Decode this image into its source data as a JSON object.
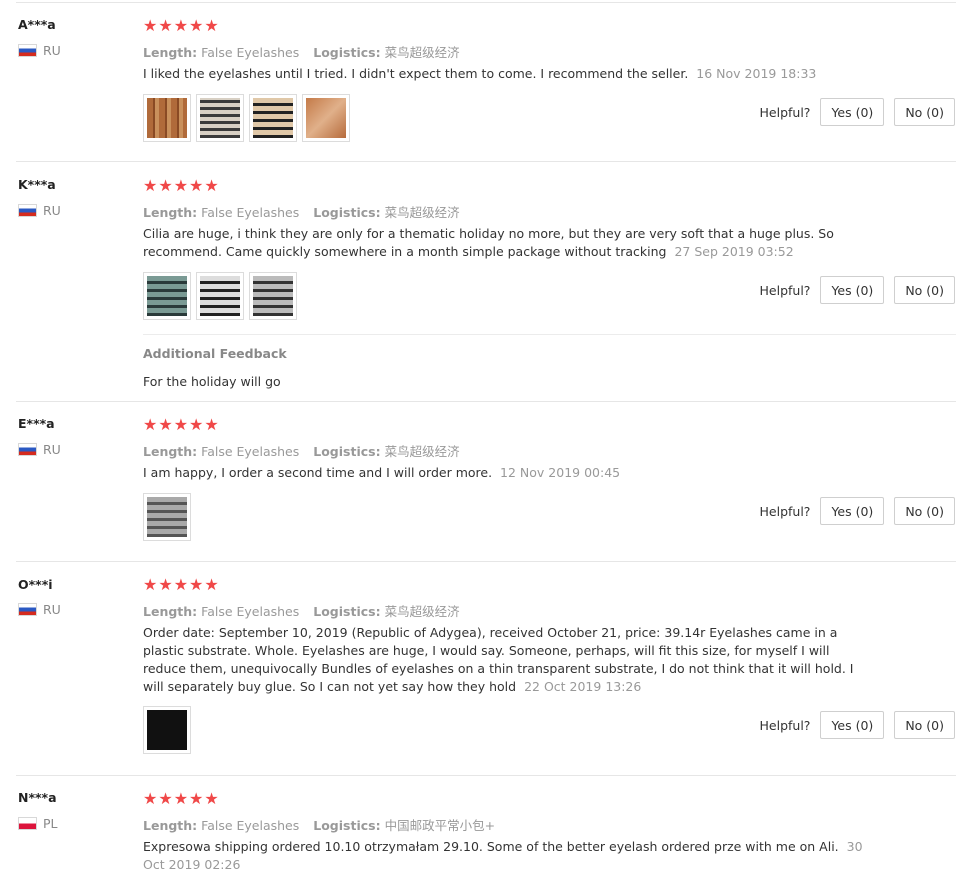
{
  "helpful_label": "Helpful?",
  "length_key": "Length:",
  "logistics_key": "Logistics:",
  "reviews": [
    {
      "user": "A***a",
      "country": "RU",
      "rating": 5,
      "length": "False Eyelashes",
      "logistics": "菜鸟超级经济",
      "text": "I liked the eyelashes until I tried. I didn't expect them to come. I recommend the seller.",
      "date": "16 Nov 2019 18:33",
      "thumbs": 4,
      "yes": "Yes (0)",
      "no": "No (0)"
    },
    {
      "user": "K***a",
      "country": "RU",
      "rating": 5,
      "length": "False Eyelashes",
      "logistics": "菜鸟超级经济",
      "text": "Cilia are huge, i think they are only for a thematic holiday no more, but they are very soft that a huge plus. So recommend. Came quickly somewhere in a month simple package without tracking",
      "date": "27 Sep 2019 03:52",
      "thumbs": 3,
      "yes": "Yes (0)",
      "no": "No (0)",
      "additional_title": "Additional Feedback",
      "additional_text": "For the holiday will go"
    },
    {
      "user": "E***a",
      "country": "RU",
      "rating": 5,
      "length": "False Eyelashes",
      "logistics": "菜鸟超级经济",
      "text": "I am happy, I order a second time and I will order more.",
      "date": "12 Nov 2019 00:45",
      "thumbs": 1,
      "yes": "Yes (0)",
      "no": "No (0)"
    },
    {
      "user": "O***i",
      "country": "RU",
      "rating": 5,
      "length": "False Eyelashes",
      "logistics": "菜鸟超级经济",
      "text": "Order date: September 10, 2019 (Republic of Adygea), received October 21, price: 39.14r Eyelashes came in a plastic substrate. Whole. Eyelashes are huge, I would say. Someone, perhaps, will fit this size, for myself I will reduce them, unequivocally Bundles of eyelashes on a thin transparent substrate, I do not think that it will hold. I will separately buy glue. So I can not yet say how they hold",
      "date": "22 Oct 2019 13:26",
      "thumbs": 1,
      "yes": "Yes (0)",
      "no": "No (0)"
    },
    {
      "user": "N***a",
      "country": "PL",
      "rating": 5,
      "length": "False Eyelashes",
      "logistics": "中国邮政平常小包+",
      "text": "Expresowa shipping ordered 10.10 otrzymałam 29.10. Some of the better eyelash ordered prze with me on Ali.",
      "date": "30 Oct 2019 02:26",
      "thumbs": 0
    }
  ]
}
